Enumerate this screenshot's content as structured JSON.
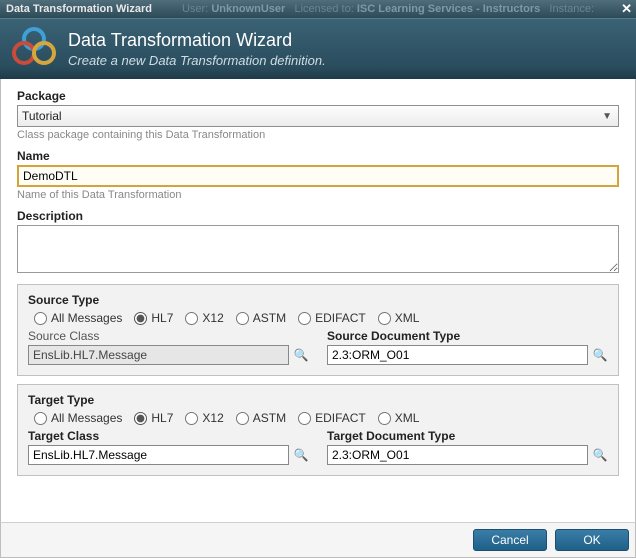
{
  "titlebar": {
    "title": "Data Transformation Wizard",
    "user_label": "User:",
    "user": "UnknownUser",
    "lic_label": "Licensed to:",
    "licensee": "ISC Learning Services - Instructors",
    "instance_label": "Instance:"
  },
  "header": {
    "title": "Data Transformation Wizard",
    "subtitle": "Create a new Data Transformation definition."
  },
  "package": {
    "label": "Package",
    "value": "Tutorial",
    "hint": "Class package containing this Data Transformation"
  },
  "name": {
    "label": "Name",
    "value": "DemoDTL",
    "hint": "Name of this Data Transformation"
  },
  "description": {
    "label": "Description",
    "value": ""
  },
  "typeOptions": [
    "All Messages",
    "HL7",
    "X12",
    "ASTM",
    "EDIFACT",
    "XML"
  ],
  "source": {
    "title": "Source Type",
    "selected": "HL7",
    "classLabel": "Source Class",
    "classValue": "EnsLib.HL7.Message",
    "docLabel": "Source Document Type",
    "docValue": "2.3:ORM_O01"
  },
  "target": {
    "title": "Target Type",
    "selected": "HL7",
    "classLabel": "Target Class",
    "classValue": "EnsLib.HL7.Message",
    "docLabel": "Target Document Type",
    "docValue": "2.3:ORM_O01"
  },
  "buttons": {
    "cancel": "Cancel",
    "ok": "OK"
  }
}
